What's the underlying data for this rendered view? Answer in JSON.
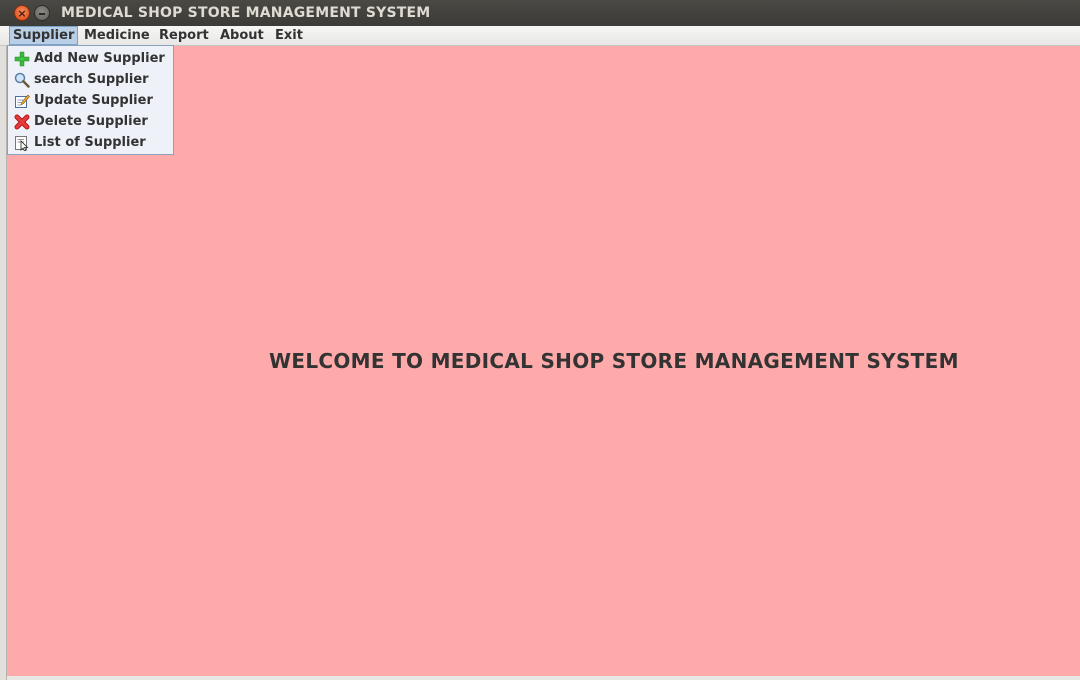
{
  "window": {
    "title": "MEDICAL SHOP STORE MANAGEMENT SYSTEM",
    "close_glyph": "×"
  },
  "menubar": {
    "items": [
      {
        "label": "Supplier"
      },
      {
        "label": "Medicine"
      },
      {
        "label": "Report"
      },
      {
        "label": "About"
      },
      {
        "label": "Exit"
      }
    ],
    "active_color": "#b8cfe5"
  },
  "supplier_menu": {
    "items": [
      {
        "label": "Add New Supplier",
        "icon": "green-plus-icon"
      },
      {
        "label": "search Supplier",
        "icon": "magnifier-icon"
      },
      {
        "label": "Update Supplier",
        "icon": "edit-pencil-icon"
      },
      {
        "label": "Delete Supplier",
        "icon": "red-x-icon"
      },
      {
        "label": "List of Supplier",
        "icon": "list-cursor-icon"
      }
    ]
  },
  "main": {
    "welcome_text": "WELCOME TO MEDICAL SHOP STORE MANAGEMENT SYSTEM",
    "background_color": "#ffaaaa"
  }
}
